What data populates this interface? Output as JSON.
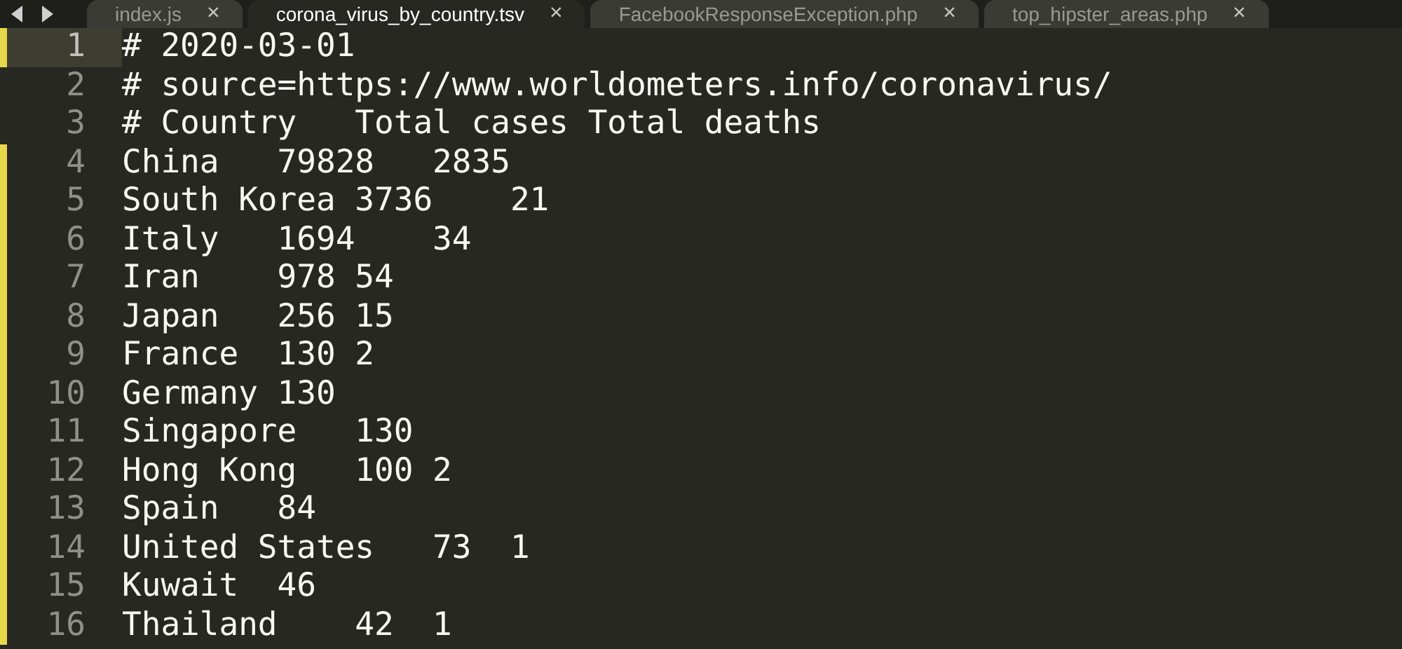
{
  "tabs": [
    {
      "label": "index.js",
      "selected": false,
      "close": "×"
    },
    {
      "label": "corona_virus_by_country.tsv",
      "selected": true,
      "close": "×"
    },
    {
      "label": "FacebookResponseException.php",
      "selected": false,
      "close": "×"
    },
    {
      "label": "top_hipster_areas.php",
      "selected": false,
      "close": "×"
    }
  ],
  "lines": [
    {
      "number": "1",
      "text": "# 2020-03-01",
      "modified": true,
      "current": true
    },
    {
      "number": "2",
      "text": "# source=https://www.worldometers.info/coronavirus/",
      "modified": false,
      "current": false
    },
    {
      "number": "3",
      "text": "# Country   Total cases Total deaths",
      "modified": false,
      "current": false
    },
    {
      "number": "4",
      "text": "China   79828   2835",
      "modified": true,
      "current": false
    },
    {
      "number": "5",
      "text": "South Korea 3736    21",
      "modified": true,
      "current": false
    },
    {
      "number": "6",
      "text": "Italy   1694    34",
      "modified": true,
      "current": false
    },
    {
      "number": "7",
      "text": "Iran    978 54",
      "modified": true,
      "current": false
    },
    {
      "number": "8",
      "text": "Japan   256 15",
      "modified": true,
      "current": false
    },
    {
      "number": "9",
      "text": "France  130 2",
      "modified": true,
      "current": false
    },
    {
      "number": "10",
      "text": "Germany 130",
      "modified": true,
      "current": false
    },
    {
      "number": "11",
      "text": "Singapore   130",
      "modified": true,
      "current": false
    },
    {
      "number": "12",
      "text": "Hong Kong   100 2",
      "modified": true,
      "current": false
    },
    {
      "number": "13",
      "text": "Spain   84",
      "modified": true,
      "current": false
    },
    {
      "number": "14",
      "text": "United States   73  1",
      "modified": true,
      "current": false
    },
    {
      "number": "15",
      "text": "Kuwait  46",
      "modified": true,
      "current": false
    },
    {
      "number": "16",
      "text": "Thailand    42  1",
      "modified": true,
      "current": false
    }
  ]
}
